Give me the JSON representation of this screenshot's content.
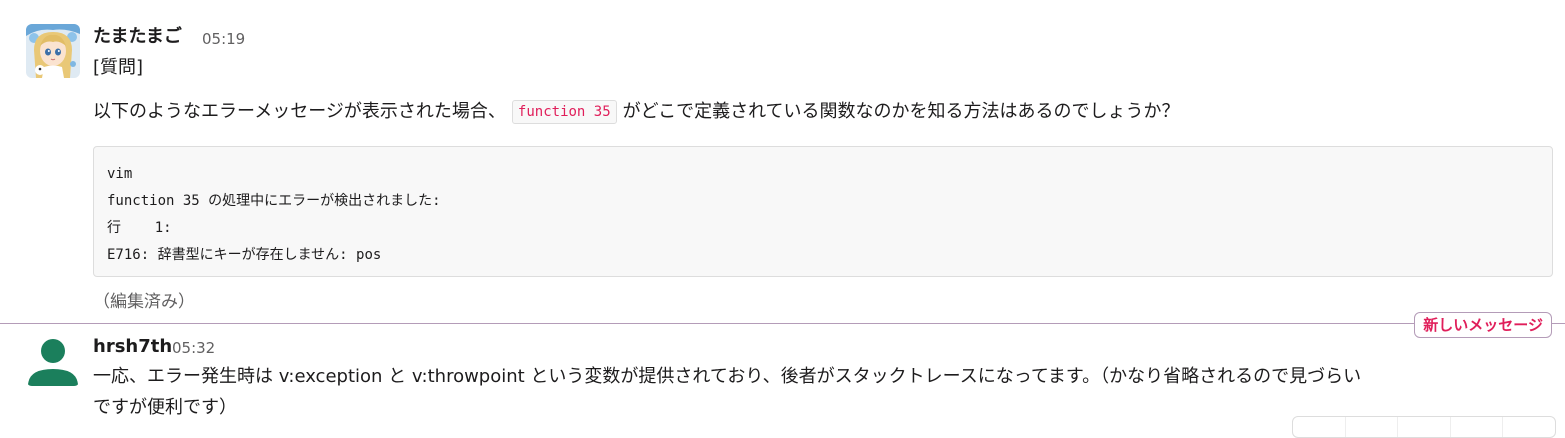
{
  "messages": [
    {
      "author": "たまたまご",
      "time": "05:19",
      "lines": [
        "[質問]"
      ],
      "question_before": "以下のようなエラーメッセージが表示された場合、",
      "inline_code": "function 35",
      "question_after": "がどこで定義されている関数なのかを知る方法はあるのでしょうか？",
      "code_lines": [
        "vim",
        "function 35 の処理中にエラーが検出されました:",
        "行    1:",
        "E716: 辞書型にキーが存在しません: pos"
      ],
      "edited_label": "（編集済み）"
    },
    {
      "author": "hrsh7th",
      "time": "05:32",
      "lines": [
        "一応、エラー発生時は v:exception と v:throwpoint という変数が提供されており、後者がスタックトレースになってます。（かなり省略されるので見づらい",
        "ですが便利です）"
      ]
    }
  ],
  "new_messages_label": "新しいメッセージ",
  "colors": {
    "accent_red": "#e01e5a",
    "divider": "#b49cb8",
    "avatar_green": "#1b7f5c"
  },
  "icons": {
    "avatar_1": "anime-character-avatar",
    "avatar_2": "default-user-avatar"
  }
}
